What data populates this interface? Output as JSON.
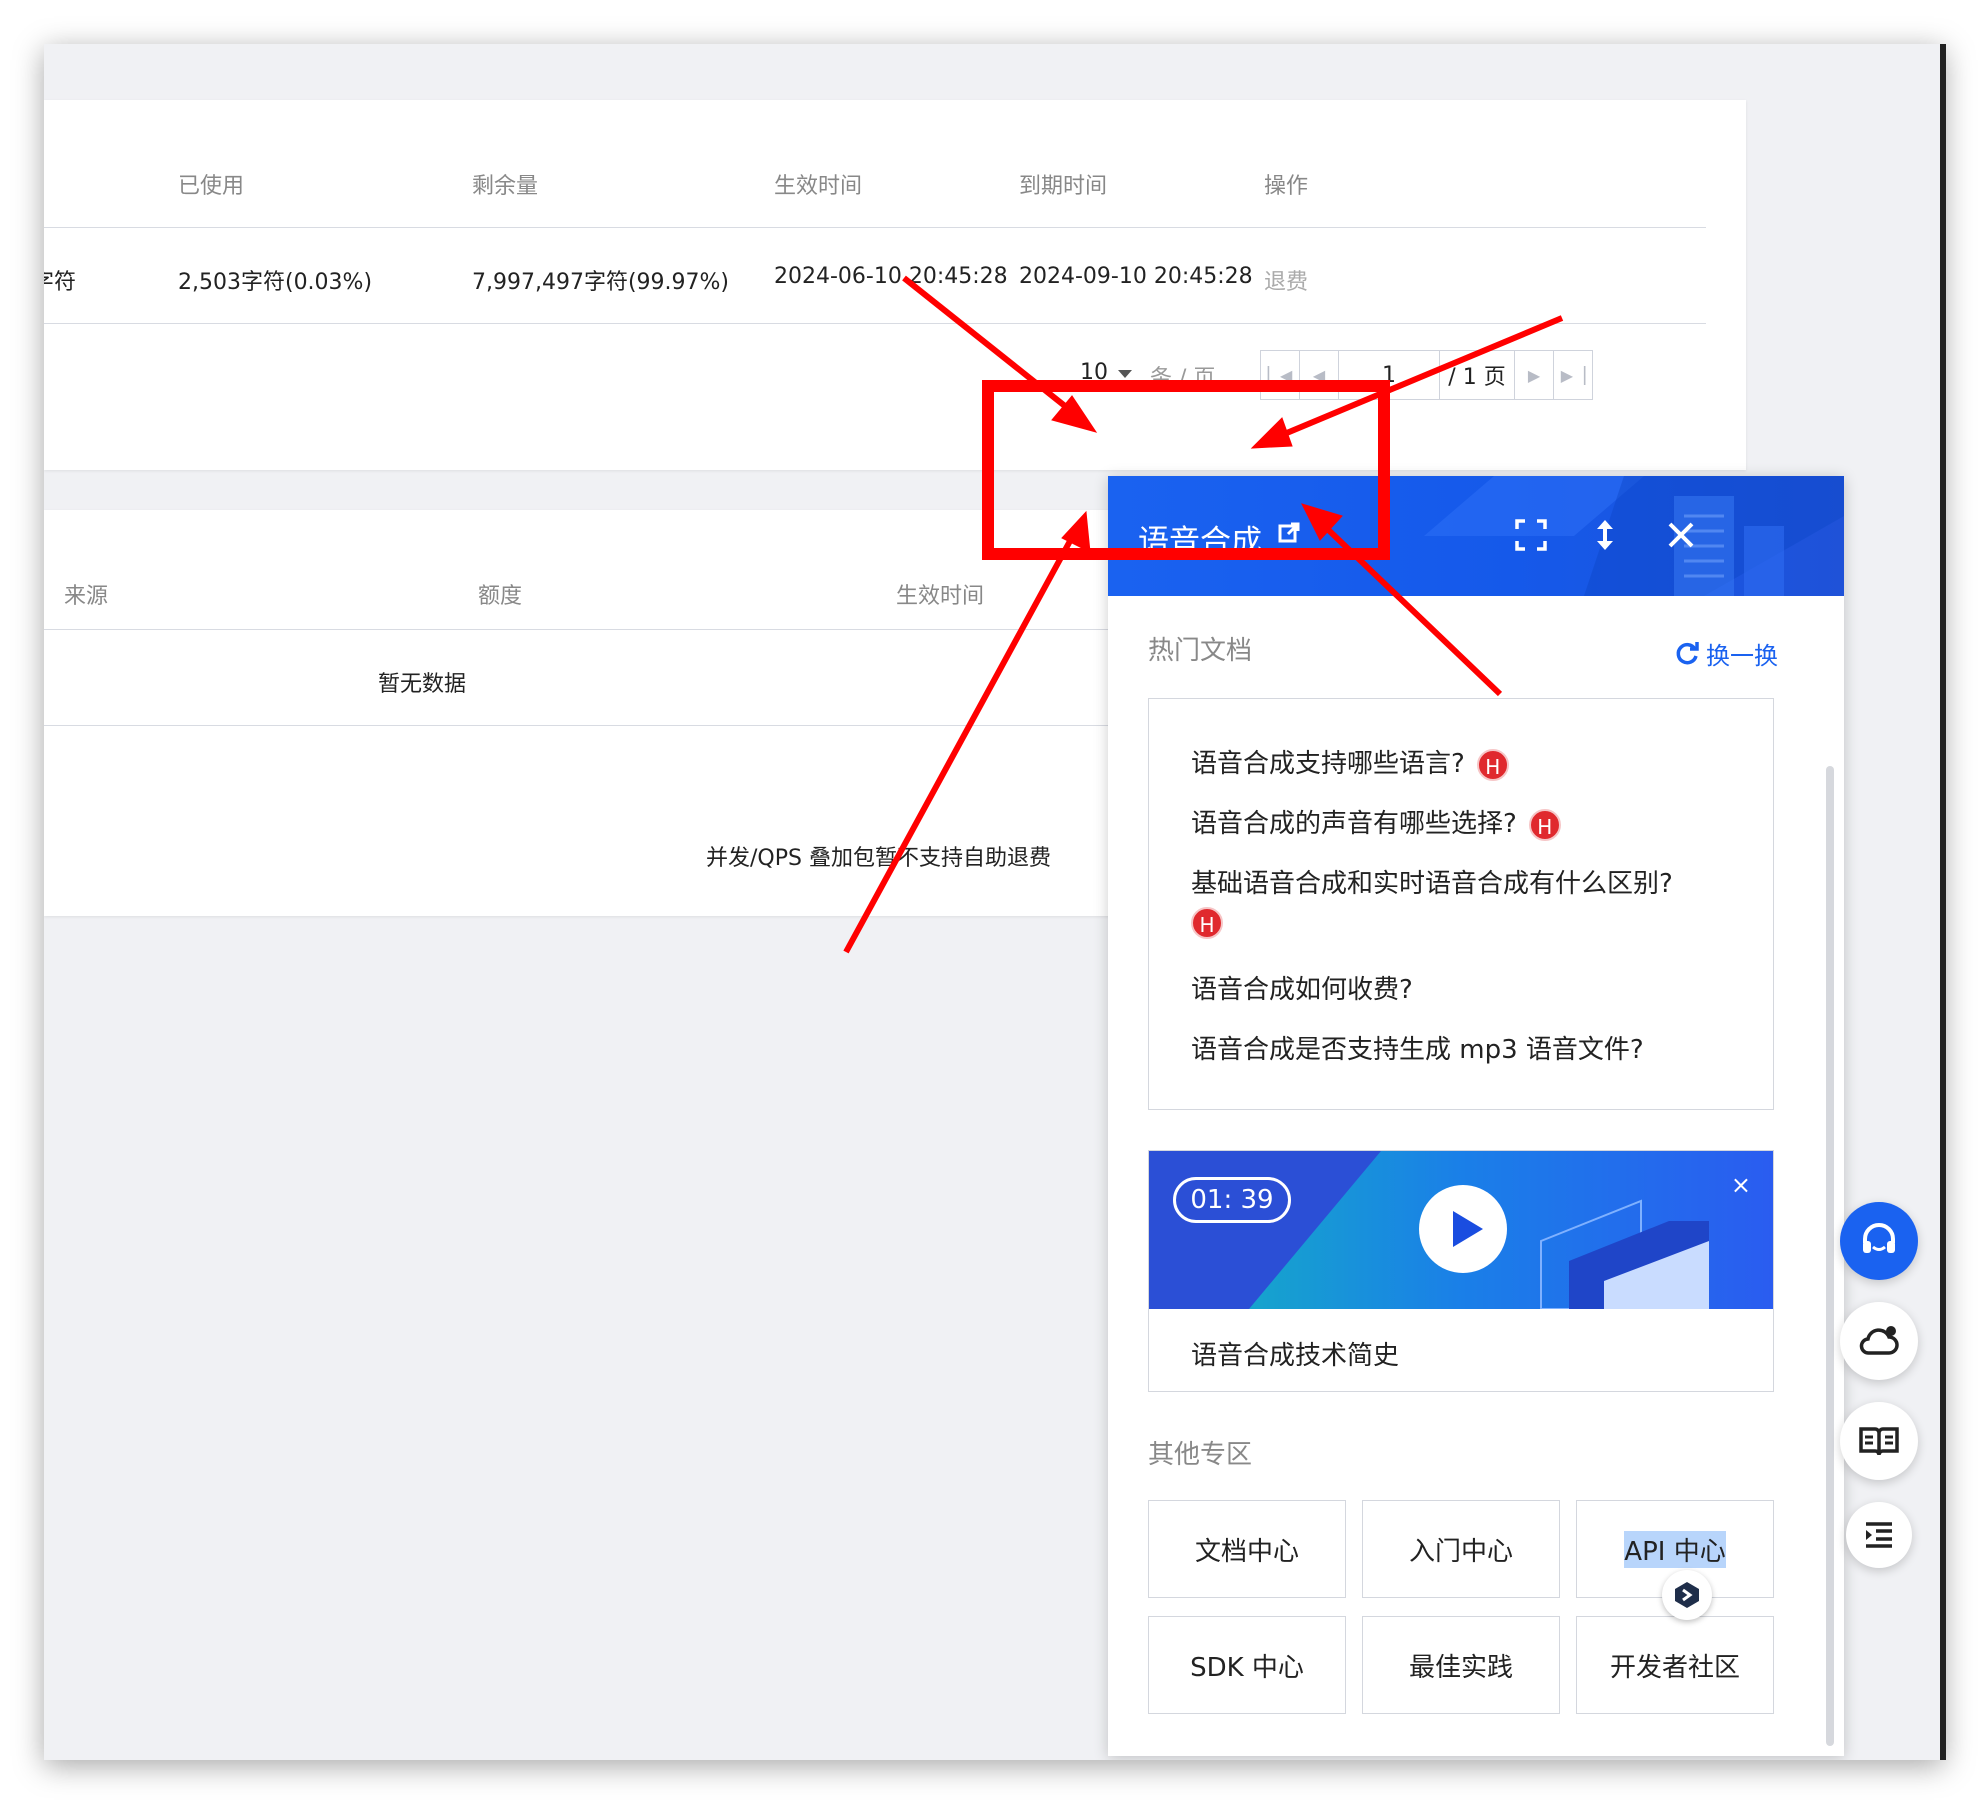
{
  "usage_table": {
    "headers": [
      "已使用",
      "剩余量",
      "生效时间",
      "到期时间",
      "操作"
    ],
    "row": {
      "partial_first_cell": "字符",
      "used": "2,503字符(0.03%)",
      "remaining": "7,997,497字符(99.97%)",
      "start_time": "2024-06-10 20:45:28",
      "end_time": "2024-09-10 20:45:28",
      "action": "退费"
    }
  },
  "pagination": {
    "page_size": "10",
    "unit": "条 / 页",
    "current_page": "1",
    "total": "/ 1 页"
  },
  "source_table": {
    "headers": [
      "来源",
      "额度",
      "生效时间"
    ],
    "empty_text": "暂无数据",
    "note": "并发/QPS 叠加包暂不支持自助退费"
  },
  "help_panel": {
    "title": "语音合成",
    "hot_docs": {
      "title": "热门文档",
      "refresh_label": "换一换",
      "items": [
        {
          "text": "语音合成支持哪些语言?",
          "hot": "H"
        },
        {
          "text": "语音合成的声音有哪些选择?",
          "hot": "H"
        },
        {
          "text": "基础语音合成和实时语音合成有什么区别?",
          "hot": "H"
        },
        {
          "text": "语音合成如何收费?"
        },
        {
          "text": "语音合成是否支持生成 mp3 语音文件?"
        }
      ]
    },
    "video": {
      "duration": "01: 39",
      "caption": "语音合成技术简史",
      "close": "×"
    },
    "other_zone": {
      "title": "其他专区",
      "items": [
        "文档中心",
        "入门中心",
        "API 中心",
        "SDK 中心",
        "最佳实践",
        "开发者社区"
      ]
    }
  },
  "colors": {
    "brand_blue": "#1a62f0",
    "hot_red": "#e0292e",
    "annotation_red": "#ff0000"
  }
}
